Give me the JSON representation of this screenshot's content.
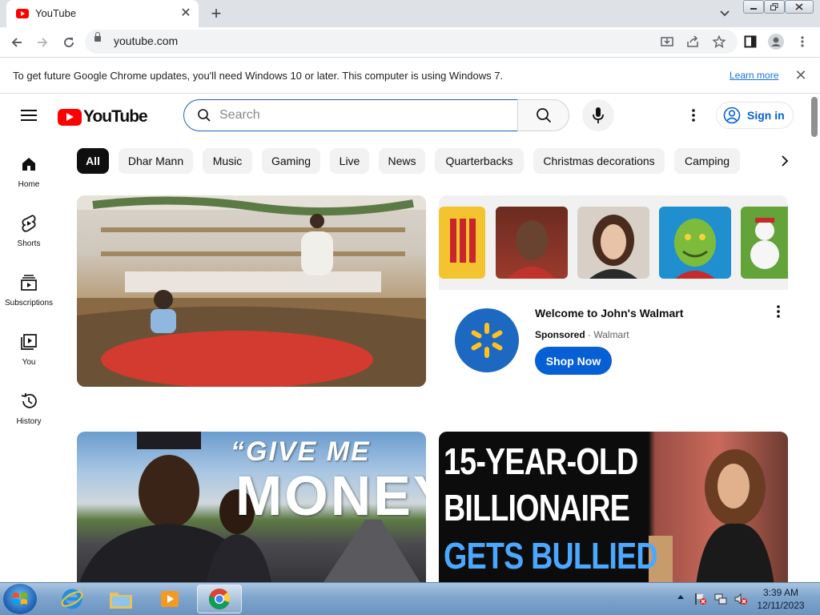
{
  "browser": {
    "tab_title": "YouTube",
    "url": "youtube.com",
    "new_tab_symbol": "+",
    "close_symbol": "✕"
  },
  "infobar": {
    "message": "To get future Google Chrome updates, you'll need Windows 10 or later. This computer is using Windows 7.",
    "link": "Learn more"
  },
  "youtube": {
    "logo_text": "YouTube",
    "search_placeholder": "Search",
    "sign_in": "Sign in",
    "sidebar": [
      {
        "label": "Home",
        "icon": "home-icon"
      },
      {
        "label": "Shorts",
        "icon": "shorts-icon"
      },
      {
        "label": "Subscriptions",
        "icon": "subscriptions-icon"
      },
      {
        "label": "You",
        "icon": "you-icon"
      },
      {
        "label": "History",
        "icon": "history-icon"
      }
    ],
    "chips": [
      "All",
      "Dhar Mann",
      "Music",
      "Gaming",
      "Live",
      "News",
      "Quarterbacks",
      "Christmas decorations",
      "Camping"
    ],
    "active_chip": "All",
    "ad": {
      "title": "Welcome to John's Walmart",
      "sponsored": "Sponsored",
      "separator": " · ",
      "advertiser": "Walmart",
      "cta": "Shop Now"
    },
    "video2_overlay": {
      "line1": "“GIVE ME",
      "line2": "MONEY”"
    },
    "video3_overlay": {
      "line1": "15-YEAR-OLD",
      "line2": "BILLIONAIRE",
      "line3": "GETS BULLIED"
    }
  },
  "taskbar": {
    "clock_time": "3:39 AM",
    "clock_date": "12/11/2023"
  },
  "colors": {
    "youtube_red": "#ff0000",
    "link_blue": "#065fd4",
    "chip_active": "#0f0f0f",
    "walmart_blue": "#1d68c0",
    "walmart_yellow": "#ffc220"
  }
}
